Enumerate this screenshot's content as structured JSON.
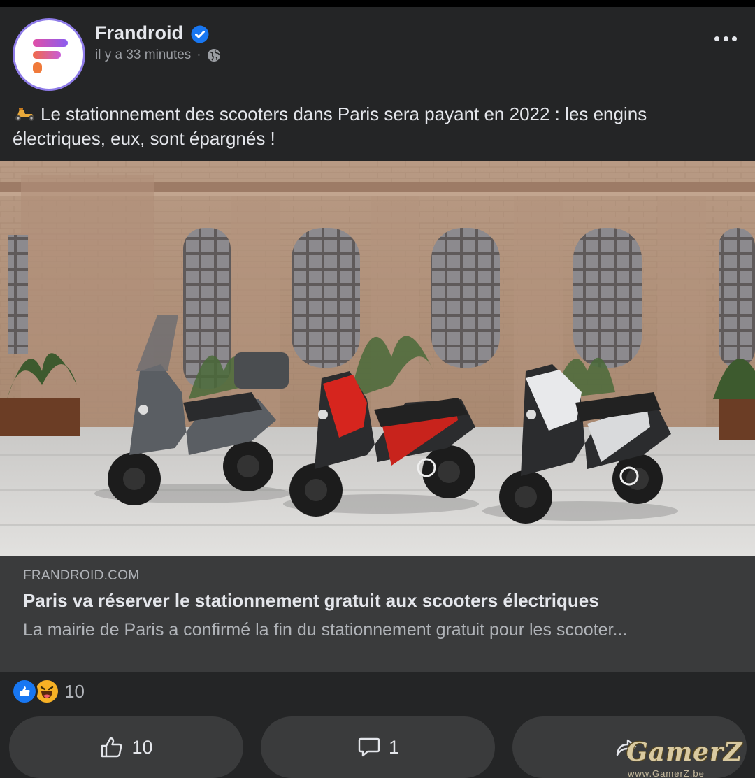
{
  "post": {
    "author": "Frandroid",
    "timestamp": "il y a 33 minutes",
    "separator": "·",
    "audience_icon": "globe-icon",
    "text": "Le stationnement des scooters dans Paris sera payant en 2022 : les engins électriques, eux, sont épargnés !",
    "text_emoji": "motor-scooter-emoji"
  },
  "link_preview": {
    "domain": "FRANDROID.COM",
    "title": "Paris va réserver le stationnement gratuit aux scooters électriques",
    "description": "La mairie de Paris a confirmé la fin du stationnement gratuit pour les scooter..."
  },
  "reactions": {
    "types": [
      "like",
      "haha"
    ],
    "count": "10"
  },
  "actions": {
    "like_count": "10",
    "comment_count": "1",
    "share_label": ""
  },
  "watermark": {
    "brand": "GamerZ",
    "url": "www.GamerZ.be"
  },
  "colors": {
    "background": "#242526",
    "link_preview_bg": "#3a3b3c",
    "verified_blue": "#1877f2",
    "primary_text": "#e4e6eb",
    "secondary_text": "#b0b3b8"
  }
}
